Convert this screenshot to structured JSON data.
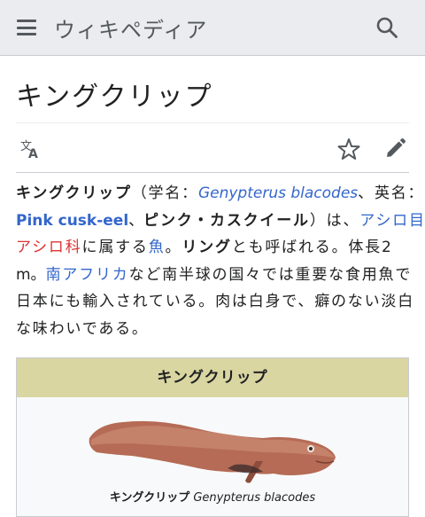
{
  "header": {
    "wordmark": "ウィキペディア"
  },
  "article": {
    "title": "キングクリップ"
  },
  "paragraph": {
    "l1_name": "キングクリップ",
    "l1_a": "（学名：",
    "l1_sci": "Genypterus blacodes",
    "l1_b": "、英名：",
    "l2_en": "Pink cusk-eel",
    "l2_a": "、",
    "l2_kana": "ピンク・カスクイール",
    "l2_b": "）は、",
    "l2_link_order": "アシロ目",
    "l3_link_family": "アシロ科",
    "l3_a": "に属する",
    "l3_link_fish": "魚",
    "l3_b": "。",
    "l3_bold_ling": "リング",
    "l3_c": "とも呼ばれる。体長2",
    "l4_a": "m。",
    "l4_link_sa": "南アフリカ",
    "l4_b": "など南半球の国々では重要な食用魚で",
    "l5": "日本にも輸入されている。肉は白身で、癖のない淡白",
    "l6": "な味わいである。"
  },
  "infobox": {
    "title": "キングクリップ",
    "caption_name": "キングクリップ",
    "caption_sci": "Genypterus blacodes"
  },
  "colors": {
    "link": "#3366cc",
    "redlink": "#dd3333",
    "infobox_header": "#d9d6a2"
  },
  "icons": [
    "menu-icon",
    "search-icon",
    "language-icon",
    "star-icon",
    "edit-icon"
  ]
}
